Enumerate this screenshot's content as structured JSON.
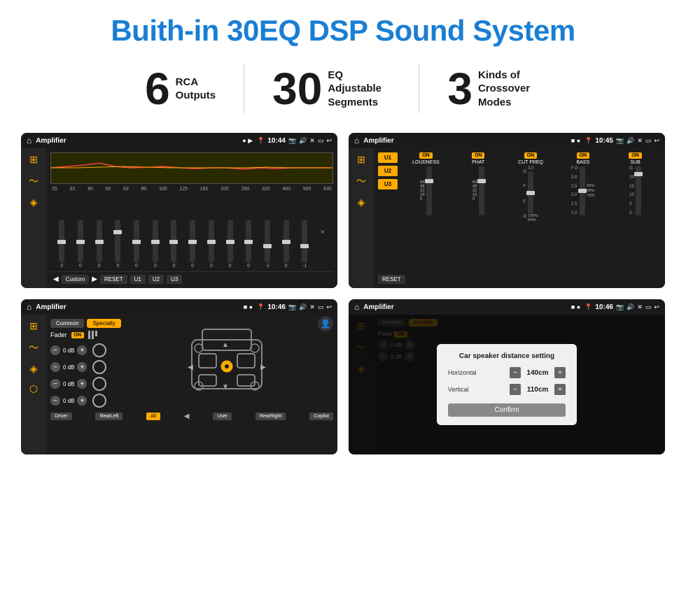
{
  "page": {
    "title": "Buith-in 30EQ DSP Sound System"
  },
  "stats": [
    {
      "number": "6",
      "label": "RCA\nOutputs"
    },
    {
      "number": "30",
      "label": "EQ Adjustable\nSegments"
    },
    {
      "number": "3",
      "label": "Kinds of\nCrossover Modes"
    }
  ],
  "screens": [
    {
      "id": "eq-screen",
      "bar": {
        "title": "Amplifier",
        "time": "10:44"
      },
      "type": "eq"
    },
    {
      "id": "amp-screen",
      "bar": {
        "title": "Amplifier",
        "time": "10:45"
      },
      "type": "amp"
    },
    {
      "id": "cross-screen",
      "bar": {
        "title": "Amplifier",
        "time": "10:46"
      },
      "type": "crossover"
    },
    {
      "id": "dialog-screen",
      "bar": {
        "title": "Amplifier",
        "time": "10:46"
      },
      "type": "dialog"
    }
  ],
  "eq": {
    "frequencies": [
      "25",
      "32",
      "40",
      "50",
      "63",
      "80",
      "100",
      "125",
      "160",
      "200",
      "250",
      "320",
      "400",
      "500",
      "630"
    ],
    "values": [
      "0",
      "0",
      "0",
      "5",
      "0",
      "0",
      "0",
      "0",
      "0",
      "0",
      "0",
      "-1",
      "0",
      "-1"
    ],
    "presets": [
      "Custom",
      "RESET",
      "U1",
      "U2",
      "U3"
    ]
  },
  "amp": {
    "presets": [
      "U1",
      "U2",
      "U3"
    ],
    "channels": [
      {
        "name": "LOUDNESS",
        "on": true,
        "value": "48"
      },
      {
        "name": "PHAT",
        "on": true,
        "value": "48"
      },
      {
        "name": "CUT FREQ",
        "on": true,
        "value": "3.0"
      },
      {
        "name": "BASS",
        "on": true,
        "value": "3.0"
      },
      {
        "name": "SUB",
        "on": true,
        "value": "20"
      }
    ],
    "resetLabel": "RESET"
  },
  "crossover": {
    "tabs": [
      "Common",
      "Specialty"
    ],
    "faderLabel": "Fader",
    "faderOn": "ON",
    "levels": [
      {
        "label": "0 dB"
      },
      {
        "label": "0 dB"
      },
      {
        "label": "0 dB"
      },
      {
        "label": "0 dB"
      }
    ],
    "buttons": [
      "Driver",
      "RearLeft",
      "All",
      "User",
      "RearRight",
      "Copilot"
    ]
  },
  "dialog": {
    "title": "Car speaker distance setting",
    "fields": [
      {
        "label": "Horizontal",
        "value": "140cm"
      },
      {
        "label": "Vertical",
        "value": "110cm"
      }
    ],
    "confirm": "Confirm",
    "rightLevels": [
      "0 dB",
      "0 dB"
    ]
  }
}
